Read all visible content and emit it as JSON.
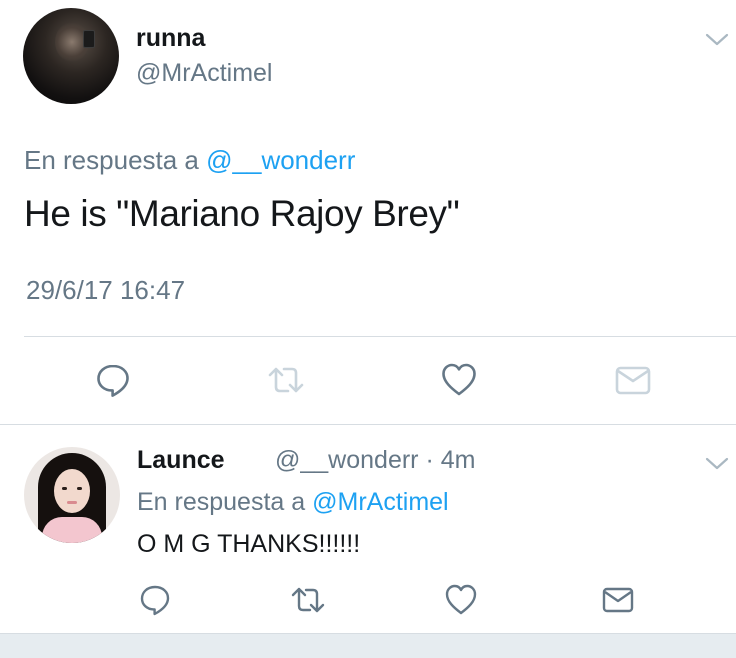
{
  "main_tweet": {
    "author_name": "runna",
    "author_handle": "@MrActimel",
    "reply_prefix": "En respuesta a",
    "reply_mention": "@__wonderr",
    "text": "He is \"Mariano Rajoy Brey\"",
    "timestamp": "29/6/17 16:47"
  },
  "reply_tweet": {
    "author_name": "Launce",
    "author_handle": "@__wonderr",
    "separator": "·",
    "age": "4m",
    "reply_prefix": "En respuesta a",
    "reply_mention": "@MrActimel",
    "text": "O M G THANKS!!!!!!"
  },
  "icons": {
    "reply": "reply-icon",
    "retweet": "retweet-icon",
    "like": "heart-icon",
    "dm": "envelope-icon",
    "menu": "chevron-down-icon"
  },
  "colors": {
    "text": "#14171a",
    "secondary": "#657786",
    "mention": "#1da1f2",
    "icon": "#657786",
    "icon_muted": "#aab8c2",
    "separator": "#d7dde2"
  }
}
